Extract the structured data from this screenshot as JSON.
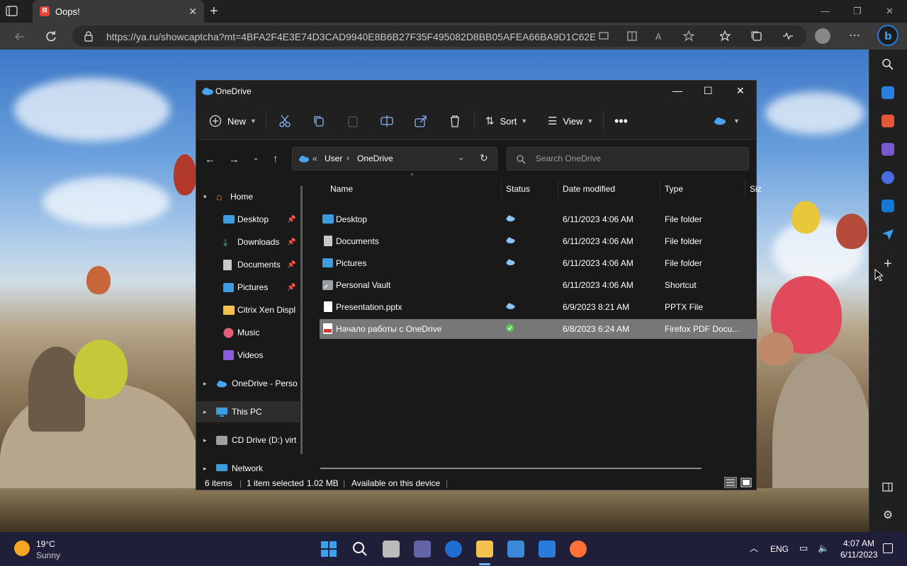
{
  "browser": {
    "tab_title": "Oops!",
    "tab_favicon": "Я",
    "url": "https://ya.ru/showcaptcha?mt=4BFA2F4E3E74D3CAD9940E8B6B27F35F495082D8BB05AFEA66BA9D1C62E8B..."
  },
  "explorer": {
    "title": "OneDrive",
    "toolbar": {
      "new_label": "New",
      "sort_label": "Sort",
      "view_label": "View"
    },
    "breadcrumb": {
      "sep": "«",
      "items": [
        "User",
        "OneDrive"
      ]
    },
    "search_placeholder": "Search OneDrive",
    "nav": {
      "home": "Home",
      "items": [
        "Desktop",
        "Downloads",
        "Documents",
        "Pictures",
        "Citrix Xen Displ",
        "Music",
        "Videos"
      ],
      "onedrive": "OneDrive - Perso",
      "this_pc": "This PC",
      "cd_drive": "CD Drive (D:) virt",
      "network": "Network"
    },
    "columns": {
      "name": "Name",
      "status": "Status",
      "date": "Date modified",
      "type": "Type",
      "size": "Siz"
    },
    "files": [
      {
        "name": "Desktop",
        "date": "6/11/2023 4:06 AM",
        "type": "File folder"
      },
      {
        "name": "Documents",
        "date": "6/11/2023 4:06 AM",
        "type": "File folder"
      },
      {
        "name": "Pictures",
        "date": "6/11/2023 4:06 AM",
        "type": "File folder"
      },
      {
        "name": "Personal Vault",
        "date": "6/11/2023 4:06 AM",
        "type": "Shortcut"
      },
      {
        "name": "Presentation.pptx",
        "date": "6/9/2023 8:21 AM",
        "type": "PPTX File"
      },
      {
        "name": "Начало работы с OneDrive",
        "date": "6/8/2023 6:24 AM",
        "type": "Firefox PDF Docu..."
      }
    ],
    "status": {
      "items": "6 items",
      "selected": "1 item selected",
      "size": "1.02 MB",
      "availability": "Available on this device"
    }
  },
  "taskbar": {
    "temp": "19°C",
    "weather": "Sunny",
    "lang": "ENG",
    "time": "4:07 AM",
    "date": "6/11/2023"
  },
  "colors": {
    "onedrive_blue": "#4aa3f0",
    "folder_yellow": "#f2c14e",
    "synced_green": "#5cc560",
    "edge_blue": "#1f6fd1"
  }
}
